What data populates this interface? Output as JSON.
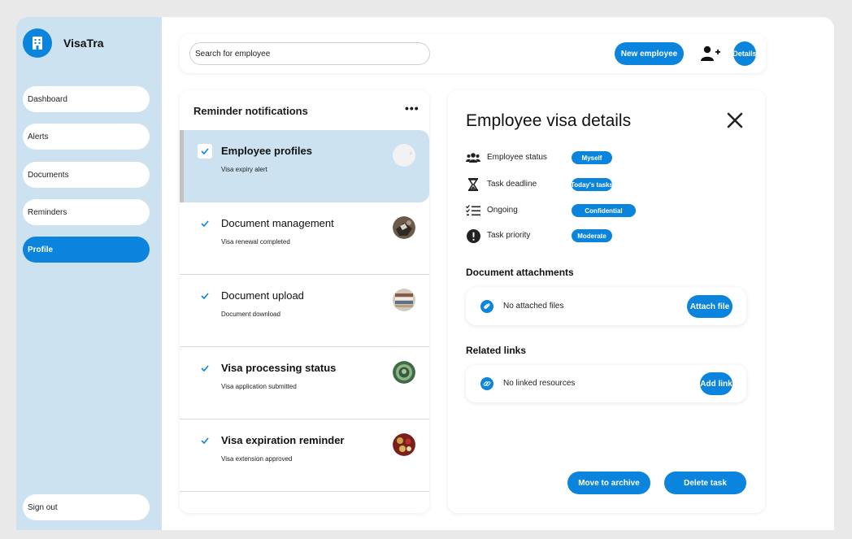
{
  "app": {
    "brand": "VisaTra"
  },
  "sidebar": {
    "items": [
      {
        "label": "Dashboard"
      },
      {
        "label": "Alerts"
      },
      {
        "label": "Documents"
      },
      {
        "label": "Reminders"
      },
      {
        "label": "Profile",
        "active": true
      }
    ],
    "sign_out": "Sign out"
  },
  "topbar": {
    "search_placeholder": "Search for employee",
    "new_employee": "New employee",
    "details": "Details"
  },
  "reminders": {
    "title": "Reminder notifications",
    "more": "•••",
    "items": [
      {
        "title": "Employee profiles",
        "subtitle": "Visa expiry alert",
        "checked": true,
        "selected": true
      },
      {
        "title": "Document management",
        "subtitle": "Visa renewal completed",
        "checked": true
      },
      {
        "title": "Document upload",
        "subtitle": "Document download",
        "checked": true
      },
      {
        "title": "Visa processing status",
        "subtitle": "Visa application submitted",
        "checked": true
      },
      {
        "title": "Visa expiration reminder",
        "subtitle": "Visa extension approved",
        "checked": true
      }
    ]
  },
  "details": {
    "title": "Employee visa details",
    "attributes": [
      {
        "label": "Employee status",
        "value": "Myself",
        "icon": "users-icon"
      },
      {
        "label": "Task deadline",
        "value": "Today's tasks",
        "icon": "hourglass-icon"
      },
      {
        "label": "Ongoing",
        "value": "Confidential",
        "icon": "checklist-icon"
      },
      {
        "label": "Task priority",
        "value": "Moderate",
        "icon": "exclamation-icon"
      }
    ],
    "attachments": {
      "title": "Document attachments",
      "empty": "No attached files",
      "button": "Attach file"
    },
    "links": {
      "title": "Related links",
      "empty": "No linked resources",
      "button": "Add link"
    },
    "archive": "Move to archive",
    "delete": "Delete task"
  },
  "colors": {
    "accent": "#0a84dc",
    "sidebar_bg": "#cde2f1",
    "selected_bg": "#cde2f1"
  }
}
